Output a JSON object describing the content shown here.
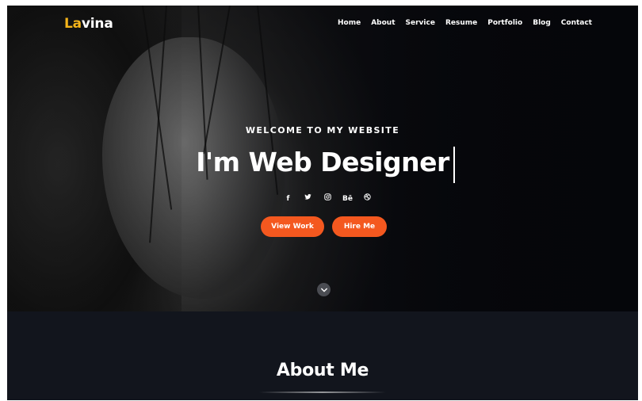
{
  "brand": {
    "logo_accent": "La",
    "logo_rest": "vina",
    "accent_color": "#f5b41a"
  },
  "nav": {
    "items": [
      {
        "label": "Home"
      },
      {
        "label": "About"
      },
      {
        "label": "Service"
      },
      {
        "label": "Resume"
      },
      {
        "label": "Portfolio"
      },
      {
        "label": "Blog"
      },
      {
        "label": "Contact"
      }
    ]
  },
  "hero": {
    "welcome": "WELCOME TO MY WEBSITE",
    "headline": "I'm Web Designer",
    "socials": [
      {
        "icon": "facebook-icon",
        "glyph": "f"
      },
      {
        "icon": "twitter-icon",
        "glyph": "🐦"
      },
      {
        "icon": "instagram-icon",
        "glyph": "◎"
      },
      {
        "icon": "behance-icon",
        "glyph": "Bē"
      },
      {
        "icon": "dribbble-icon",
        "glyph": "⊛"
      }
    ],
    "view_work_label": "View Work",
    "hire_me_label": "Hire Me",
    "button_color": "#f4581f",
    "scroll_icon": "chevron-down-icon"
  },
  "about": {
    "title": "About Me"
  }
}
